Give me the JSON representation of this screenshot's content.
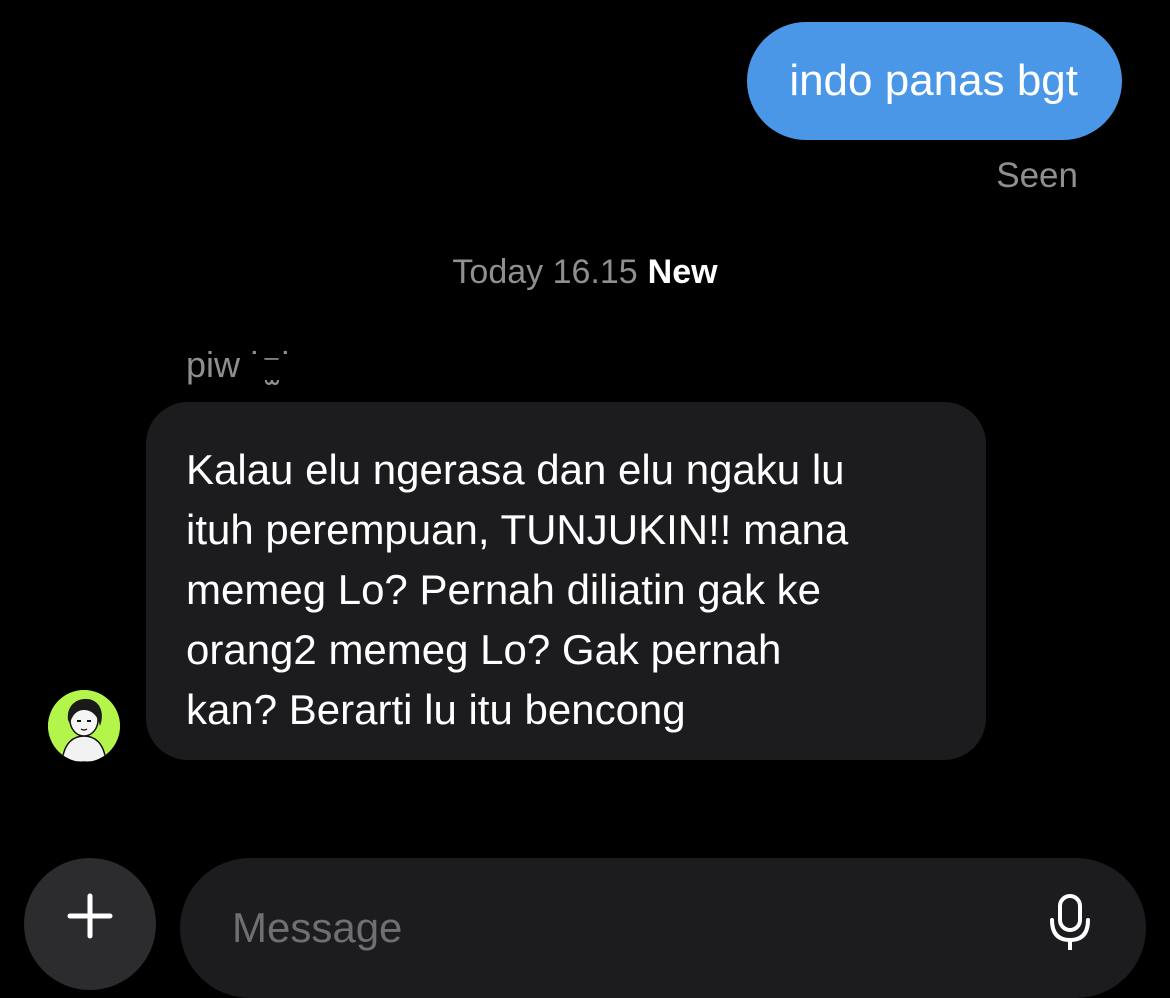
{
  "conversation": {
    "sent_message": "indo panas bgt",
    "seen_status": "Seen",
    "timestamp": "Today 16.15",
    "new_label": "New",
    "sender_name": "piw ˙⁻̫˙",
    "received_message": "Kalau elu ngerasa dan elu ngaku lu\nituh perempuan, TUNJUKIN!! mana\nmemeg Lo?  Pernah diliatin gak ke\norang2 memeg Lo? Gak pernah\nkan? Berarti lu itu bencong"
  },
  "composer": {
    "placeholder": "Message",
    "add_icon": "plus-icon",
    "mic_icon": "microphone-icon"
  },
  "colors": {
    "background": "#000000",
    "sent_bubble": "#4a97e8",
    "received_bubble": "#1c1c1e",
    "secondary_text": "#8f8f8f",
    "avatar_bg": "#b3f54a"
  }
}
